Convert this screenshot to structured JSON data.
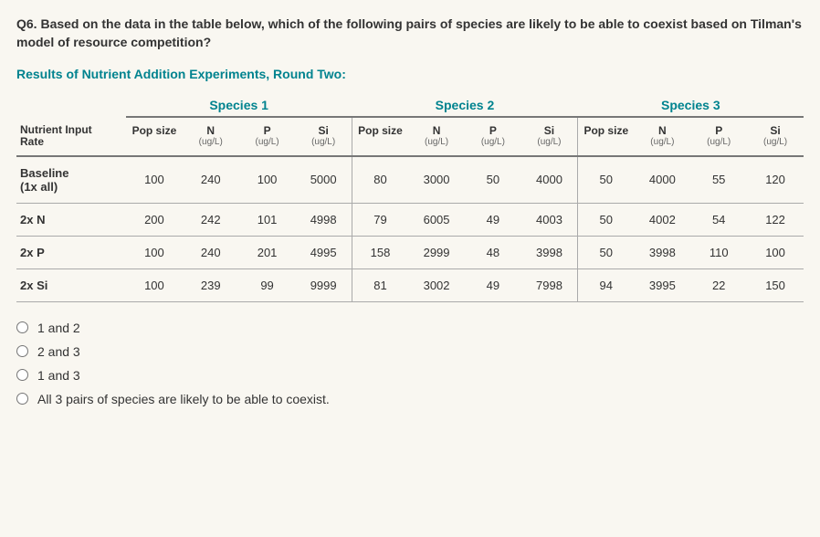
{
  "question": "Q6. Based on the data in the table below, which of the following pairs of species are likely to be able to coexist based on Tilman's model of resource competition?",
  "subtitle": "Results of Nutrient Addition Experiments, Round Two:",
  "species_labels": [
    "Species 1",
    "Species 2",
    "Species 3"
  ],
  "row_header_label_line1": "Nutrient Input",
  "row_header_label_line2": "Rate",
  "column_headers": [
    {
      "label": "Pop size",
      "unit": ""
    },
    {
      "label": "N",
      "unit": "(ug/L)"
    },
    {
      "label": "P",
      "unit": "(ug/L)"
    },
    {
      "label": "Si",
      "unit": "(ug/L)"
    }
  ],
  "rows": [
    {
      "label_line1": "Baseline",
      "label_line2": "(1x all)",
      "s1": [
        "100",
        "240",
        "100",
        "5000"
      ],
      "s2": [
        "80",
        "3000",
        "50",
        "4000"
      ],
      "s3": [
        "50",
        "4000",
        "55",
        "120"
      ]
    },
    {
      "label_line1": "2x N",
      "label_line2": "",
      "s1": [
        "200",
        "242",
        "101",
        "4998"
      ],
      "s2": [
        "79",
        "6005",
        "49",
        "4003"
      ],
      "s3": [
        "50",
        "4002",
        "54",
        "122"
      ]
    },
    {
      "label_line1": "2x P",
      "label_line2": "",
      "s1": [
        "100",
        "240",
        "201",
        "4995"
      ],
      "s2": [
        "158",
        "2999",
        "48",
        "3998"
      ],
      "s3": [
        "50",
        "3998",
        "110",
        "100"
      ]
    },
    {
      "label_line1": "2x Si",
      "label_line2": "",
      "s1": [
        "100",
        "239",
        "99",
        "9999"
      ],
      "s2": [
        "81",
        "3002",
        "49",
        "7998"
      ],
      "s3": [
        "94",
        "3995",
        "22",
        "150"
      ]
    }
  ],
  "options": [
    "1 and 2",
    "2 and 3",
    "1 and 3",
    "All 3 pairs of species are likely to be able to coexist."
  ],
  "chart_data": {
    "type": "table",
    "title": "Results of Nutrient Addition Experiments, Round Two",
    "row_labels": [
      "Baseline (1x all)",
      "2x N",
      "2x P",
      "2x Si"
    ],
    "groups": [
      "Species 1",
      "Species 2",
      "Species 3"
    ],
    "columns_per_group": [
      "Pop size",
      "N (ug/L)",
      "P (ug/L)",
      "Si (ug/L)"
    ],
    "data": {
      "Species 1": [
        [
          100,
          240,
          100,
          5000
        ],
        [
          200,
          242,
          101,
          4998
        ],
        [
          100,
          240,
          201,
          4995
        ],
        [
          100,
          239,
          99,
          9999
        ]
      ],
      "Species 2": [
        [
          80,
          3000,
          50,
          4000
        ],
        [
          79,
          6005,
          49,
          4003
        ],
        [
          158,
          2999,
          48,
          3998
        ],
        [
          81,
          3002,
          49,
          7998
        ]
      ],
      "Species 3": [
        [
          50,
          4000,
          55,
          120
        ],
        [
          50,
          4002,
          54,
          122
        ],
        [
          50,
          3998,
          110,
          100
        ],
        [
          94,
          3995,
          22,
          150
        ]
      ]
    }
  }
}
